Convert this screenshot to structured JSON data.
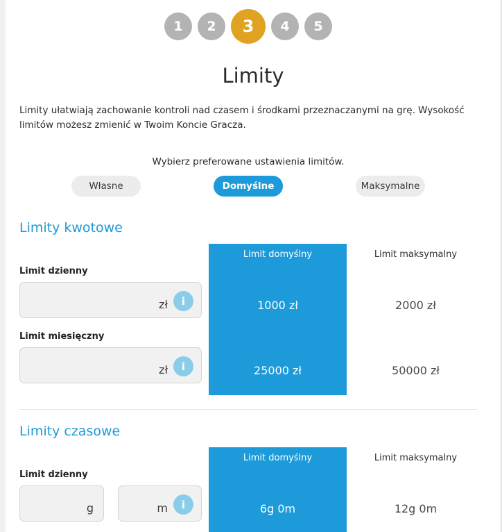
{
  "steps": [
    "1",
    "2",
    "3",
    "4",
    "5"
  ],
  "active_step": "3",
  "title": "Limity",
  "intro": "Limity ułatwiają zachowanie kontroli nad czasem i środkami przeznaczanymi na grę. Wysokość limitów możesz zmienić w Twoim Koncie Gracza.",
  "choose_label": "Wybierz preferowane ustawienia limitów.",
  "options": {
    "own": "Własne",
    "default": "Domyślne",
    "max": "Maksymalne",
    "selected": "Domyślne"
  },
  "amount_limits": {
    "title": "Limity kwotowe",
    "default_header": "Limit domyślny",
    "max_header": "Limit maksymalny",
    "daily": {
      "label": "Limit dzienny",
      "unit": "zł",
      "value": "",
      "default": "1000 zł",
      "max": "2000 zł"
    },
    "monthly": {
      "label": "Limit miesięczny",
      "unit": "zł",
      "value": "",
      "default": "25000 zł",
      "max": "50000 zł"
    }
  },
  "time_limits": {
    "title": "Limity czasowe",
    "default_header": "Limit domyślny",
    "max_header": "Limit maksymalny",
    "daily": {
      "label": "Limit dzienny",
      "hours_unit": "g",
      "minutes_unit": "m",
      "hours_value": "",
      "minutes_value": "",
      "default": "6g 0m",
      "max": "12g 0m"
    }
  },
  "info_glyph": "i",
  "colors": {
    "accent": "#1c9ad9",
    "active_step": "#e0a321",
    "inactive_step": "#b3b3b3",
    "info": "#8acde9"
  }
}
